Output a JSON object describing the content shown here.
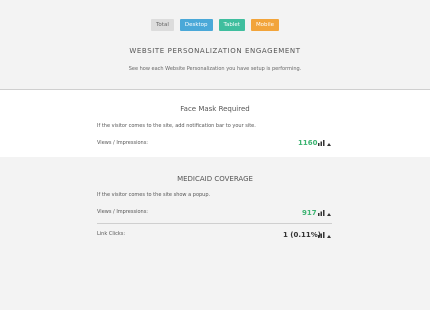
{
  "filters": {
    "total": "Total",
    "desktop": "Desktop",
    "tablet": "Tablet",
    "mobile": "Mobile"
  },
  "header": {
    "title": "WEBSITE PERSONALIZATION ENGAGEMENT",
    "subtitle": "See how each Website Personalization you have setup is performing."
  },
  "cards": [
    {
      "title": "Face Mask Required",
      "description": "If the visitor comes to the site, add notification bar to your site.",
      "metrics": [
        {
          "label": "Views / Impressions:",
          "value": "1160"
        }
      ]
    },
    {
      "title": "MEDICAID COVERAGE",
      "description": "If the visitor comes to the site show a popup.",
      "metrics": [
        {
          "label": "Views / Impressions:",
          "value": "917"
        },
        {
          "label": "Link Clicks:",
          "value": "1 (0.11%)"
        }
      ]
    }
  ],
  "colors": {
    "green": "#3cb371",
    "desktop": "#4aa8d8",
    "tablet": "#3fbe9e",
    "mobile": "#f2a43a"
  }
}
